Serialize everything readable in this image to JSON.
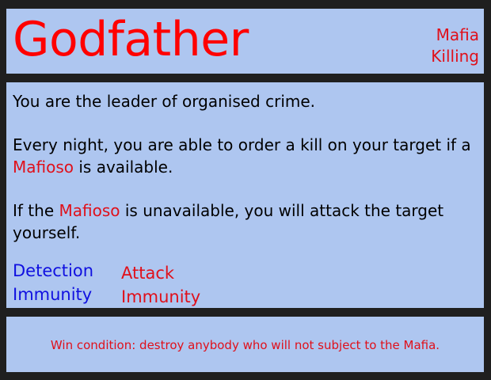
{
  "header": {
    "title": "Godfather",
    "tags": [
      "Mafia",
      "Killing"
    ]
  },
  "description": {
    "line1": "You are the leader of organised crime.",
    "line2_part1": "Every night, you are able to order a kill on your target if a ",
    "line2_keyword": "Mafioso",
    "line2_part2": " is available.",
    "line3_part1": "If the ",
    "line3_keyword": "Mafioso",
    "line3_part2": " is unavailable, you will attack the target yourself."
  },
  "immunities": {
    "detection": [
      "Detection",
      "Immunity"
    ],
    "attack": [
      "Attack",
      "Immunity"
    ]
  },
  "footer": {
    "win_condition": "Win condition: destroy anybody who will not subject to the Mafia."
  },
  "colors": {
    "background": "#1f1f1f",
    "panel": "#aec6f0",
    "title_red": "#ff0000",
    "keyword_red": "#e0101a",
    "detection_blue": "#1010e0"
  }
}
